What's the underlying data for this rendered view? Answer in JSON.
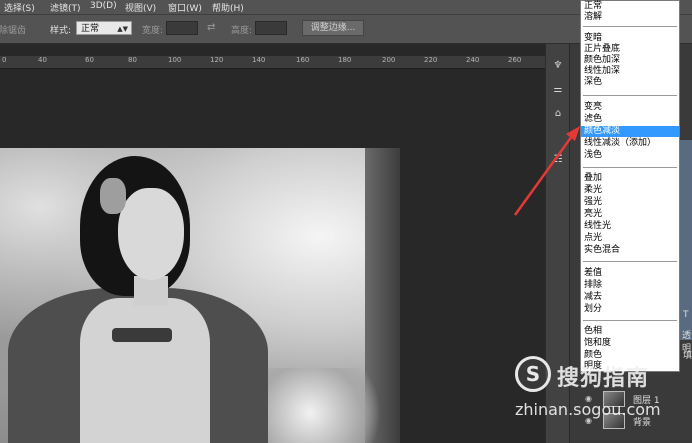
{
  "menubar": {
    "items": [
      "选择(S)",
      "滤镜(T)",
      "3D(D)",
      "视图(V)",
      "窗口(W)",
      "帮助(H)"
    ]
  },
  "options_bar": {
    "partial_left_label": "消除锯齿",
    "style_label": "样式:",
    "style_value": "正常",
    "width_label": "宽度:",
    "height_label": "高度:",
    "refine_edge_button": "调整边缘..."
  },
  "ruler": {
    "ticks": [
      "0",
      "40",
      "60",
      "80",
      "100",
      "120",
      "140",
      "160",
      "180",
      "200",
      "220",
      "240",
      "260"
    ]
  },
  "blend_mode_menu": {
    "groups": [
      [
        "正常",
        "溶解"
      ],
      [
        "变暗",
        "正片叠底",
        "颜色加深",
        "线性加深",
        "深色"
      ],
      [
        "变亮",
        "滤色",
        "颜色减淡",
        "线性减淡（添加）",
        "浅色"
      ],
      [
        "叠加",
        "柔光",
        "强光",
        "亮光",
        "线性光",
        "点光",
        "实色混合"
      ],
      [
        "差值",
        "排除",
        "减去",
        "划分"
      ],
      [
        "色相",
        "饱和度",
        "颜色",
        "明度"
      ]
    ],
    "selected": "颜色减淡"
  },
  "layers": {
    "items": [
      "图层 1",
      "背景"
    ]
  },
  "panel_side": {
    "t_label": "T",
    "opacity_fragment": "透明",
    "fill_fragment": "填"
  },
  "watermark": {
    "brand": "搜狗指南",
    "url": "zhinan.sogou.com"
  },
  "colors": {
    "selection": "#3399ff",
    "arrow": "#e53935"
  }
}
